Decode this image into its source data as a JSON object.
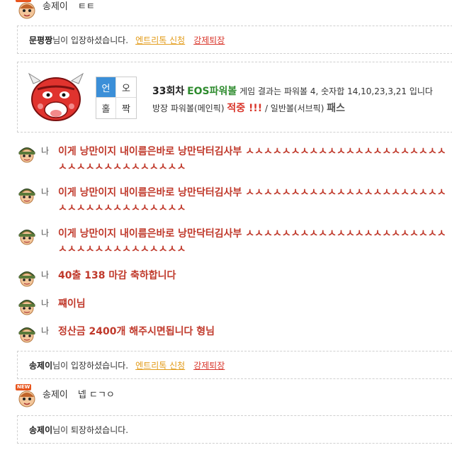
{
  "messages": [
    {
      "nick": "송제이",
      "text": "ㅌㅌ"
    },
    {
      "nick": "송제이",
      "text": "넵 ㄷㄱㅇ"
    }
  ],
  "notice1": {
    "name": "문평짱",
    "suffix": "님이 입장하셨습니다.",
    "entry": "엔트리톡 신청",
    "kick": "강제퇴장"
  },
  "result": {
    "grid": [
      "언",
      "오",
      "홀",
      "짝"
    ],
    "round": "33회차",
    "game": "EOS파워볼",
    "desc": "게임 결과는 파워볼 4, 숫자합 14,10,23,3,21 입니다",
    "owner": "방장 파워볼(메인픽)",
    "hit": "적중 !!!",
    "sep": " / 일반볼(서브픽) ",
    "pass": "패스"
  },
  "my_label": "나",
  "my_messages": [
    "이게 낭만이지 내이름은바로 낭만닥터김사부 ㅅㅅㅅㅅㅅㅅㅅㅅㅅㅅㅅㅅㅅㅅㅅㅅㅅㅅㅅㅅㅅㅅㅅㅅㅅㅅㅅㅅㅅㅅㅅㅅㅅㅅㅅㅅ",
    "이게 낭만이지 내이름은바로 낭만닥터김사부 ㅅㅅㅅㅅㅅㅅㅅㅅㅅㅅㅅㅅㅅㅅㅅㅅㅅㅅㅅㅅㅅㅅㅅㅅㅅㅅㅅㅅㅅㅅㅅㅅㅅㅅㅅㅅ",
    "이게 낭만이지 내이름은바로 낭만닥터김사부 ㅅㅅㅅㅅㅅㅅㅅㅅㅅㅅㅅㅅㅅㅅㅅㅅㅅㅅㅅㅅㅅㅅㅅㅅㅅㅅㅅㅅㅅㅅㅅㅅㅅㅅㅅㅅ",
    "40출 138 마감 축하합니다",
    "쨰이님",
    "정산금 2400개 해주시면됩니다 형님"
  ],
  "notice2": {
    "name": "송제이",
    "suffix": "님이 입장하셨습니다.",
    "entry": "엔트리톡 신청",
    "kick": "강제퇴장"
  },
  "notice3": {
    "name": "송제이",
    "suffix": "님이 퇴장하셨습니다."
  },
  "new_badge": "NEW"
}
